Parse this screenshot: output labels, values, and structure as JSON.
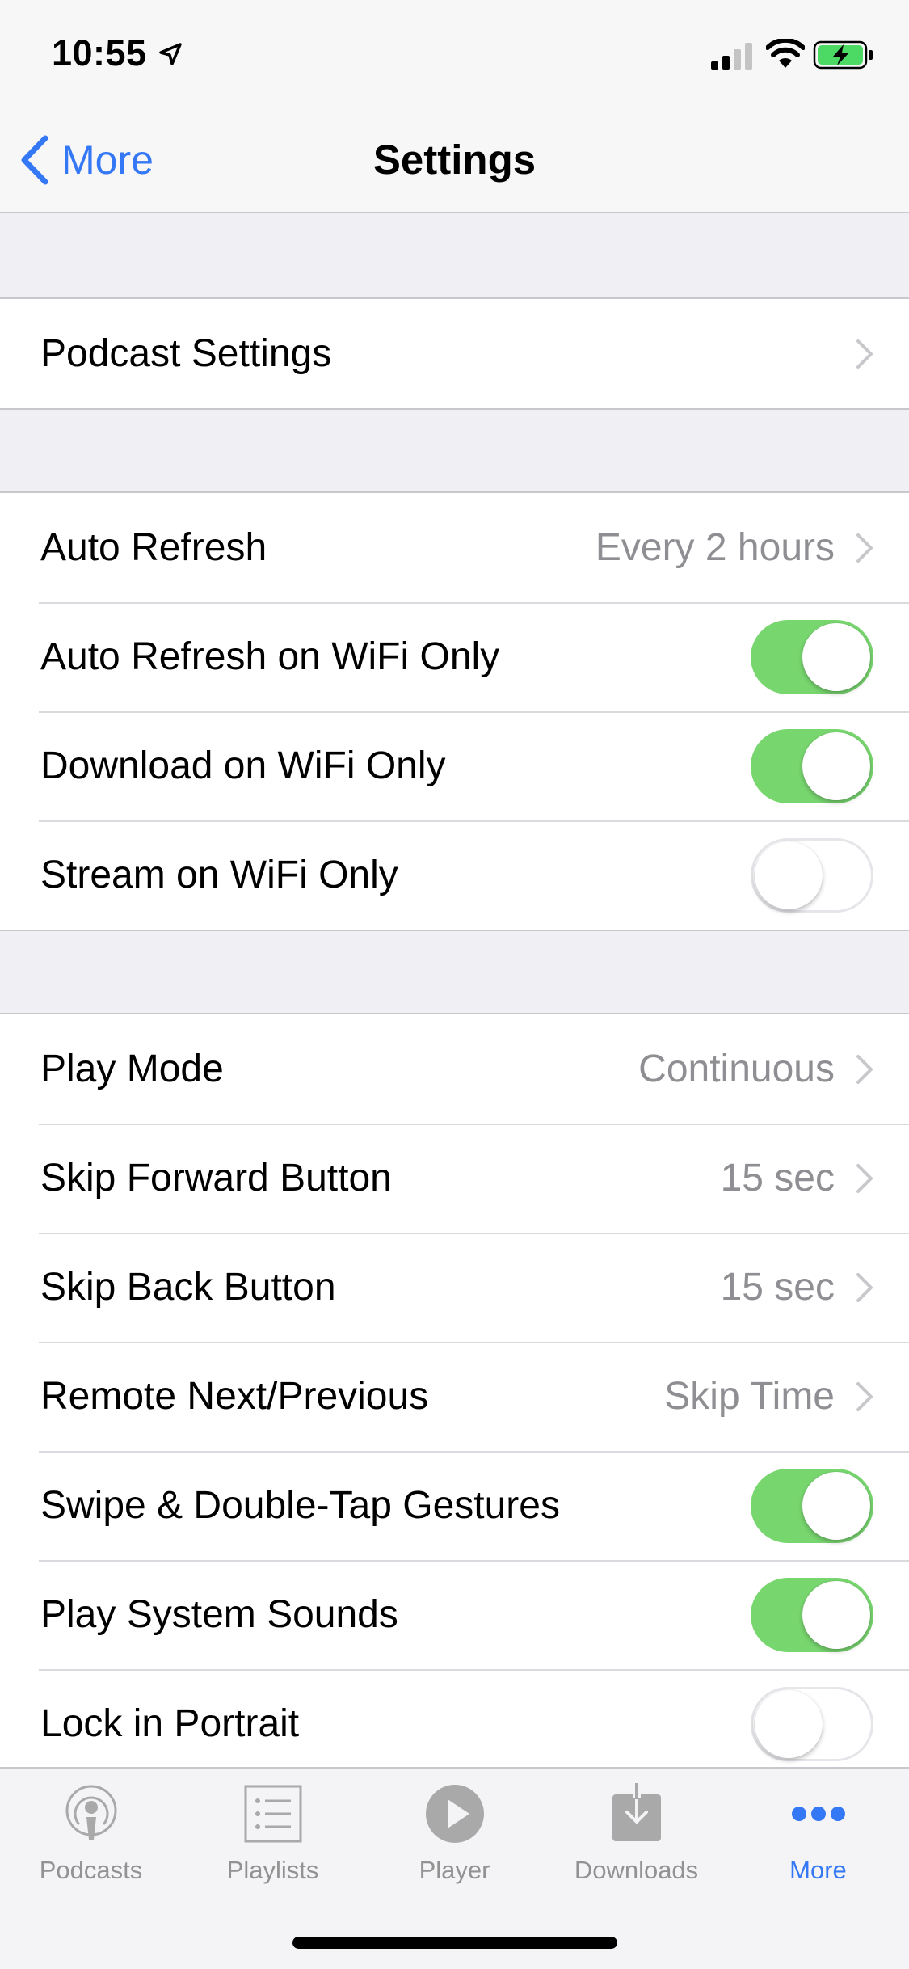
{
  "status_bar": {
    "time": "10:55"
  },
  "nav": {
    "back_label": "More",
    "title": "Settings"
  },
  "sections": [
    {
      "rows": [
        {
          "label": "Podcast Settings",
          "value": "",
          "control": "chevron"
        }
      ]
    },
    {
      "rows": [
        {
          "label": "Auto Refresh",
          "value": "Every 2 hours",
          "control": "chevron"
        },
        {
          "label": "Auto Refresh on WiFi Only",
          "control": "toggle",
          "on": true
        },
        {
          "label": "Download on WiFi Only",
          "control": "toggle",
          "on": true
        },
        {
          "label": "Stream on WiFi Only",
          "control": "toggle",
          "on": false
        }
      ]
    },
    {
      "rows": [
        {
          "label": "Play Mode",
          "value": "Continuous",
          "control": "chevron"
        },
        {
          "label": "Skip Forward Button",
          "value": "15 sec",
          "control": "chevron"
        },
        {
          "label": "Skip Back Button",
          "value": "15 sec",
          "control": "chevron"
        },
        {
          "label": "Remote Next/Previous",
          "value": "Skip Time",
          "control": "chevron"
        },
        {
          "label": "Swipe & Double-Tap Gestures",
          "control": "toggle",
          "on": true
        },
        {
          "label": "Play System Sounds",
          "control": "toggle",
          "on": true
        },
        {
          "label": "Lock in Portrait",
          "control": "toggle",
          "on": false
        }
      ]
    }
  ],
  "tab_bar": {
    "tabs": [
      {
        "label": "Podcasts",
        "icon": "podcasts-icon",
        "active": false
      },
      {
        "label": "Playlists",
        "icon": "playlists-icon",
        "active": false
      },
      {
        "label": "Player",
        "icon": "player-icon",
        "active": false
      },
      {
        "label": "Downloads",
        "icon": "downloads-icon",
        "active": false
      },
      {
        "label": "More",
        "icon": "more-icon",
        "active": true
      }
    ]
  },
  "colors": {
    "accent": "#3478f6",
    "toggle_on": "#78d66f",
    "secondary_text": "#8e8e93",
    "grouped_background": "#efeff4"
  }
}
